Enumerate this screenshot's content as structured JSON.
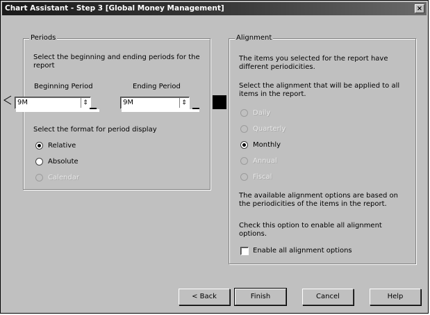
{
  "window": {
    "title": "Chart Assistant - Step 3   [Global Money Management]",
    "close_glyph": "×"
  },
  "periods": {
    "legend": "Periods",
    "instruction": "Select the beginning and ending periods for the report",
    "beginning_label": "Beginning Period",
    "beginning_value": "9M",
    "ending_label": "Ending Period",
    "ending_value": "9M",
    "format_label": "Select the format for period display",
    "options": [
      {
        "label": "Relative",
        "selected": true,
        "enabled": true
      },
      {
        "label": "Absolute",
        "selected": false,
        "enabled": true
      },
      {
        "label": "Calendar",
        "selected": false,
        "enabled": false
      }
    ],
    "swatch_color": "#000000"
  },
  "alignment": {
    "legend": "Alignment",
    "intro": "The items you selected for the report have different periodicities.",
    "instruction": "Select the alignment that will be applied to all items in the report.",
    "options": [
      {
        "label": "Daily",
        "selected": false,
        "enabled": false
      },
      {
        "label": "Quarterly",
        "selected": false,
        "enabled": false
      },
      {
        "label": "Monthly",
        "selected": true,
        "enabled": true
      },
      {
        "label": "Annual",
        "selected": false,
        "enabled": false
      },
      {
        "label": "Fiscal",
        "selected": false,
        "enabled": false
      }
    ],
    "note": "The available alignment options are based on the periodicities of the items in the report.",
    "check_note": "Check this option to enable all alignment options.",
    "check_label": "Enable all alignment options",
    "check_checked": false
  },
  "buttons": {
    "back": "< Back",
    "finish": "Finish",
    "cancel": "Cancel",
    "help": "Help"
  },
  "colors": {
    "face": "#c0c0c0",
    "titlebar": "#1a1a1a",
    "field_bg": "#ffffff"
  }
}
